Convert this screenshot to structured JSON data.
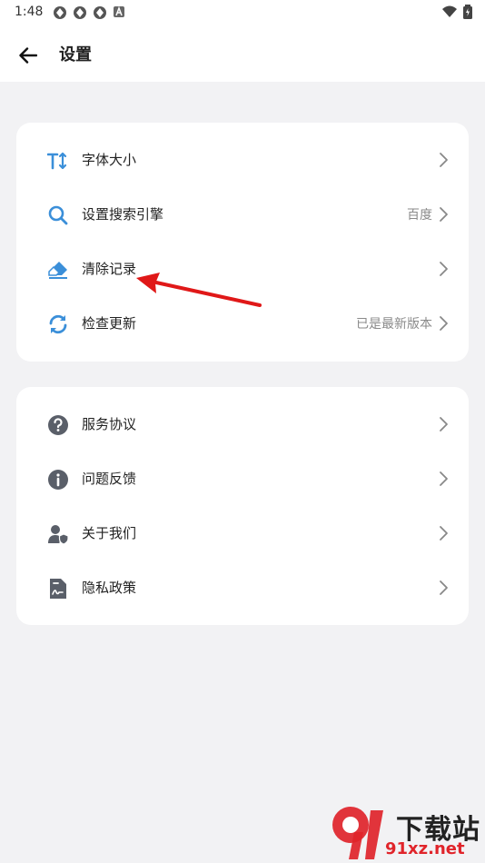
{
  "status_bar": {
    "time": "1:48",
    "left_icons": [
      "notification-icon",
      "notification-icon",
      "notification-icon",
      "a-icon"
    ],
    "right_icons": [
      "wifi-icon",
      "battery-icon"
    ]
  },
  "app_bar": {
    "title": "设置",
    "back_icon": "arrow-left-icon"
  },
  "colors": {
    "accent_blue": "#3b8fd9",
    "gray_icon": "#5a5f69",
    "arrow_red": "#e01818",
    "background": "#f2f2f4"
  },
  "card1": {
    "items": [
      {
        "label": "字体大小",
        "value": "",
        "icon": "font-size-icon"
      },
      {
        "label": "设置搜索引擎",
        "value": "百度",
        "icon": "search-icon"
      },
      {
        "label": "清除记录",
        "value": "",
        "icon": "eraser-icon"
      },
      {
        "label": "检查更新",
        "value": "已是最新版本",
        "icon": "refresh-icon"
      }
    ]
  },
  "card2": {
    "items": [
      {
        "label": "服务协议",
        "value": "",
        "icon": "question-icon"
      },
      {
        "label": "问题反馈",
        "value": "",
        "icon": "info-icon"
      },
      {
        "label": "关于我们",
        "value": "",
        "icon": "user-shield-icon"
      },
      {
        "label": "隐私政策",
        "value": "",
        "icon": "document-icon"
      }
    ]
  },
  "watermark": {
    "title": "下载站",
    "url": "91xz.net"
  }
}
